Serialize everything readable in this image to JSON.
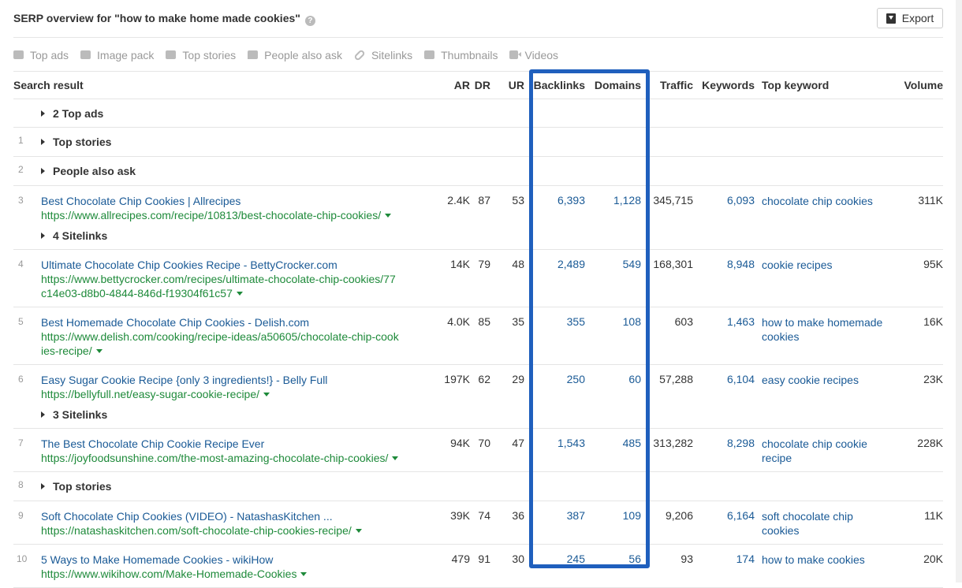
{
  "header": {
    "title": "SERP overview for \"how to make home made cookies\"",
    "help": "?",
    "export_label": "Export"
  },
  "filters": [
    {
      "label": "Top ads",
      "icon": "ads-icon"
    },
    {
      "label": "Image pack",
      "icon": "image-icon"
    },
    {
      "label": "Top stories",
      "icon": "newspaper-icon"
    },
    {
      "label": "People also ask",
      "icon": "question-chat-icon"
    },
    {
      "label": "Sitelinks",
      "icon": "link-icon"
    },
    {
      "label": "Thumbnails",
      "icon": "image-icon"
    },
    {
      "label": "Videos",
      "icon": "video-camera-icon"
    }
  ],
  "columns": {
    "search_result": "Search result",
    "ar": "AR",
    "dr": "DR",
    "ur": "UR",
    "backlinks": "Backlinks",
    "domains": "Domains",
    "traffic": "Traffic",
    "keywords": "Keywords",
    "top_keyword": "Top keyword",
    "volume": "Volume"
  },
  "groups": {
    "top_ads": "2 Top ads",
    "top_stories_1": {
      "rank": "1",
      "label": "Top stories"
    },
    "people_also_ask": {
      "rank": "2",
      "label": "People also ask"
    },
    "top_stories_8": {
      "rank": "8",
      "label": "Top stories"
    }
  },
  "results": [
    {
      "rank": "3",
      "title": "Best Chocolate Chip Cookies | Allrecipes",
      "url": "https://www.allrecipes.com/recipe/10813/best-chocolate-chip-cookies/",
      "ar": "2.4K",
      "dr": "87",
      "ur": "53",
      "backlinks": "6,393",
      "domains": "1,128",
      "traffic": "345,715",
      "keywords": "6,093",
      "top_keyword": "chocolate chip cookies",
      "volume": "311K",
      "sitelinks": "4 Sitelinks"
    },
    {
      "rank": "4",
      "title": "Ultimate Chocolate Chip Cookies Recipe - BettyCrocker.com",
      "url": "https://www.bettycrocker.com/recipes/ultimate-chocolate-chip-cookies/77c14e03-d8b0-4844-846d-f19304f61c57",
      "ar": "14K",
      "dr": "79",
      "ur": "48",
      "backlinks": "2,489",
      "domains": "549",
      "traffic": "168,301",
      "keywords": "8,948",
      "top_keyword": "cookie recipes",
      "volume": "95K"
    },
    {
      "rank": "5",
      "title": "Best Homemade Chocolate Chip Cookies - Delish.com",
      "url": "https://www.delish.com/cooking/recipe-ideas/a50605/chocolate-chip-cookies-recipe/",
      "ar": "4.0K",
      "dr": "85",
      "ur": "35",
      "backlinks": "355",
      "domains": "108",
      "traffic": "603",
      "keywords": "1,463",
      "top_keyword": "how to make homemade cookies",
      "volume": "16K"
    },
    {
      "rank": "6",
      "title": "Easy Sugar Cookie Recipe {only 3 ingredients!} - Belly Full",
      "url": "https://bellyfull.net/easy-sugar-cookie-recipe/",
      "ar": "197K",
      "dr": "62",
      "ur": "29",
      "backlinks": "250",
      "domains": "60",
      "traffic": "57,288",
      "keywords": "6,104",
      "top_keyword": "easy cookie recipes",
      "volume": "23K",
      "sitelinks": "3 Sitelinks"
    },
    {
      "rank": "7",
      "title": "The Best Chocolate Chip Cookie Recipe Ever",
      "url": "https://joyfoodsunshine.com/the-most-amazing-chocolate-chip-cookies/",
      "ar": "94K",
      "dr": "70",
      "ur": "47",
      "backlinks": "1,543",
      "domains": "485",
      "traffic": "313,282",
      "keywords": "8,298",
      "top_keyword": "chocolate chip cookie recipe",
      "volume": "228K"
    },
    {
      "rank": "9",
      "title": "Soft Chocolate Chip Cookies (VIDEO) - NatashasKitchen ...",
      "url": "https://natashaskitchen.com/soft-chocolate-chip-cookies-recipe/",
      "ar": "39K",
      "dr": "74",
      "ur": "36",
      "backlinks": "387",
      "domains": "109",
      "traffic": "9,206",
      "keywords": "6,164",
      "top_keyword": "soft chocolate chip cookies",
      "volume": "11K"
    },
    {
      "rank": "10",
      "title": "5 Ways to Make Homemade Cookies - wikiHow",
      "url": "https://www.wikihow.com/Make-Homemade-Cookies",
      "ar": "479",
      "dr": "91",
      "ur": "30",
      "backlinks": "245",
      "domains": "56",
      "traffic": "93",
      "keywords": "174",
      "top_keyword": "how to make cookies",
      "volume": "20K"
    }
  ],
  "highlight_color": "#1f5fbd"
}
